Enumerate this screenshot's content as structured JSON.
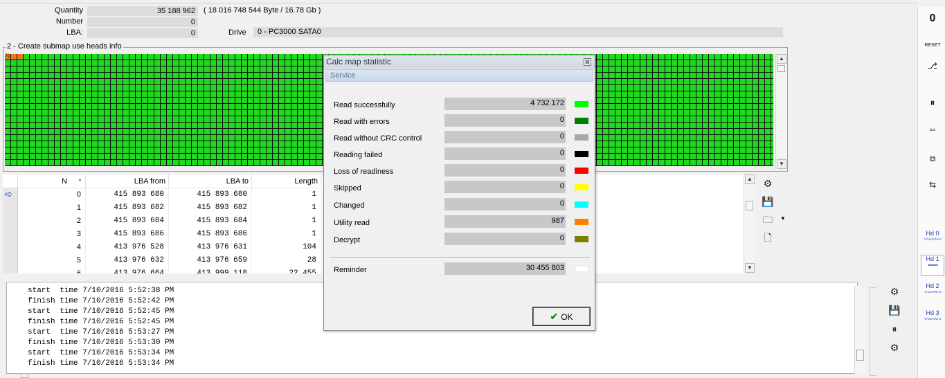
{
  "info": {
    "quantity_label": "Quantity",
    "quantity_value": "35 188 962",
    "quantity_extra": "( 18 016 748 544 Byte /  16.78 Gb )",
    "number_label": "Number",
    "number_value": "0",
    "lba_label": "LBA:",
    "lba_value": "0",
    "drive_label": "Drive",
    "drive_value": "0 - PC3000 SATA0"
  },
  "map": {
    "group_title": "2 - Create submap use heads info",
    "marker_glyph": "N"
  },
  "table": {
    "headers": {
      "n": "N",
      "sort_glyph": "▲",
      "lba_from": "LBA from",
      "lba_to": "LBA to",
      "length": "Length"
    },
    "current_row_icon": "arrow-right-icon",
    "rows": [
      {
        "n": "0",
        "from": "415 893 680",
        "to": "415 893 680",
        "length": "1"
      },
      {
        "n": "1",
        "from": "415 893 682",
        "to": "415 893 682",
        "length": "1"
      },
      {
        "n": "2",
        "from": "415 893 684",
        "to": "415 893 684",
        "length": "1"
      },
      {
        "n": "3",
        "from": "415 893 686",
        "to": "415 893 686",
        "length": "1"
      },
      {
        "n": "4",
        "from": "413 976 528",
        "to": "413 976 631",
        "length": "104"
      },
      {
        "n": "5",
        "from": "413 976 632",
        "to": "413 976 659",
        "length": "28"
      },
      {
        "n": "6",
        "from": "413 976 664",
        "to": "413 999 118",
        "length": "22 455"
      }
    ]
  },
  "log": {
    "lines": [
      "start  time 7/10/2016 5:52:38 PM",
      "finish time 7/10/2016 5:52:42 PM",
      "start  time 7/10/2016 5:52:45 PM",
      "finish time 7/10/2016 5:52:45 PM",
      "start  time 7/10/2016 5:53:27 PM",
      "finish time 7/10/2016 5:53:30 PM",
      "start  time 7/10/2016 5:53:34 PM",
      "finish time 7/10/2016 5:53:34 PM"
    ]
  },
  "dialog": {
    "title": "Calc map statistic",
    "close_glyph": "⊠",
    "tab": "Service",
    "stats": [
      {
        "label": "Read successfully",
        "value": "4 732 172",
        "color": "#00ff00"
      },
      {
        "label": "Read with errors",
        "value": "0",
        "color": "#008000"
      },
      {
        "label": "Read without CRC control",
        "value": "0",
        "color": "#a8a8a8"
      },
      {
        "label": "Reading failed",
        "value": "0",
        "color": "#000000"
      },
      {
        "label": "Loss of readiness",
        "value": "0",
        "color": "#ff0000"
      },
      {
        "label": "Skipped",
        "value": "0",
        "color": "#ffff00"
      },
      {
        "label": "Changed",
        "value": "0",
        "color": "#00ffff"
      },
      {
        "label": "Utility read",
        "value": "987",
        "color": "#ff8000"
      },
      {
        "label": "Decrypt",
        "value": "0",
        "color": "#808000"
      }
    ],
    "reminder": {
      "label": "Reminder",
      "value": "30 455 803",
      "color": "#ffffff"
    },
    "ok_label": "OK",
    "ok_icon": "checkmark-icon"
  },
  "right_toolbar": {
    "zero_label": "0",
    "reset_label": "RESET",
    "heads": [
      "Hd 0",
      "Hd 1",
      "Hd 2",
      "Hd 3"
    ],
    "active_head": "Hd 1"
  }
}
